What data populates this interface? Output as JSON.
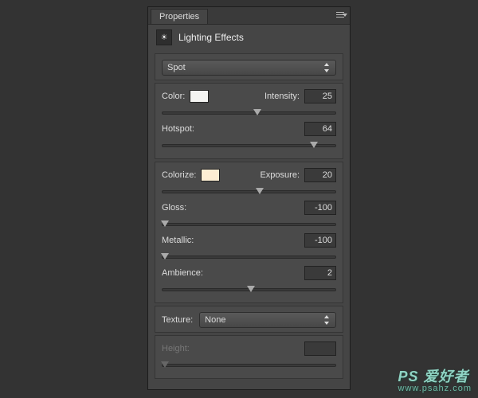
{
  "tab": "Properties",
  "title": "Lighting Effects",
  "lightType": "Spot",
  "labels": {
    "color": "Color:",
    "intensity": "Intensity:",
    "hotspot": "Hotspot:",
    "colorize": "Colorize:",
    "exposure": "Exposure:",
    "gloss": "Gloss:",
    "metallic": "Metallic:",
    "ambience": "Ambience:",
    "texture": "Texture:",
    "height": "Height:"
  },
  "values": {
    "intensity": "25",
    "hotspot": "64",
    "exposure": "20",
    "gloss": "-100",
    "metallic": "-100",
    "ambience": "2",
    "texture": "None",
    "height": ""
  },
  "swatches": {
    "color": "#f4f4f2",
    "colorize": "#fdeed3"
  },
  "sliderPos": {
    "intensity": 55,
    "hotspot": 87,
    "exposure": 56,
    "gloss": 2,
    "metallic": 2,
    "ambience": 51,
    "height": 2
  },
  "watermark": {
    "main": "PS 爱好者",
    "sub": "www.psahz.com"
  }
}
